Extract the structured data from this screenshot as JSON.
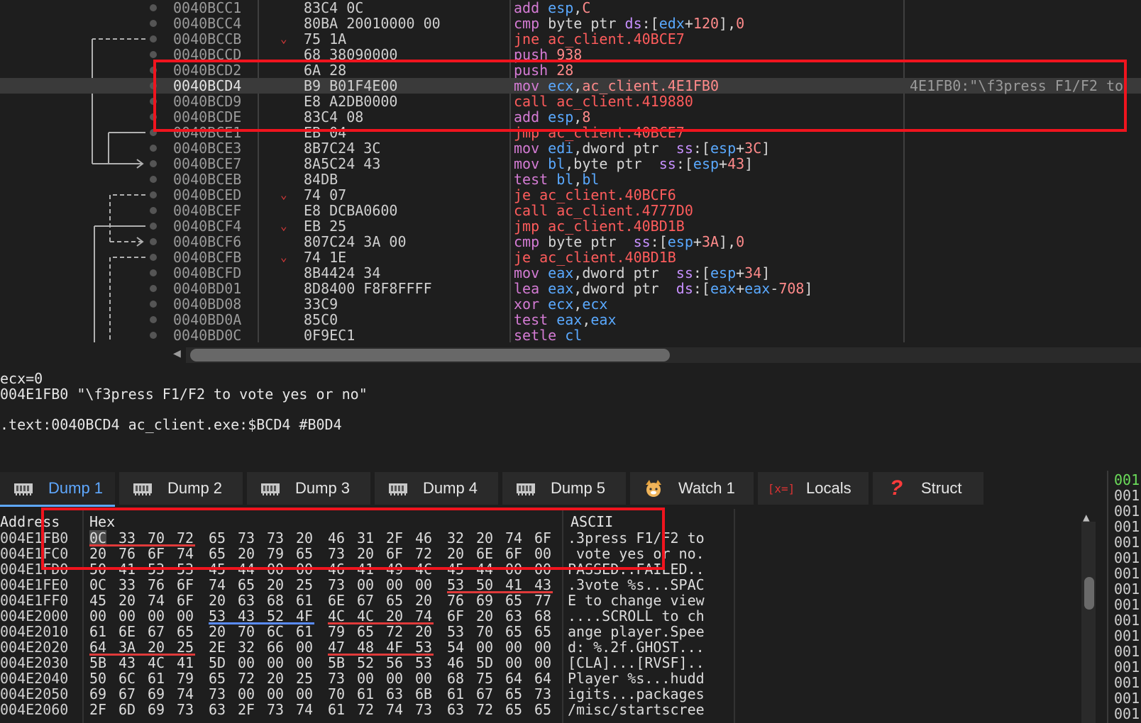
{
  "disasm": {
    "rows": [
      {
        "addr": "0040BCC1",
        "chev": "",
        "bytes": "83C4 0C",
        "parts": [
          [
            "add",
            "mn"
          ],
          [
            " ",
            "txt"
          ],
          [
            "esp",
            "reg"
          ],
          [
            ",",
            "txt"
          ],
          [
            "C",
            "imm"
          ]
        ]
      },
      {
        "addr": "0040BCC4",
        "chev": "",
        "bytes": "80BA 20010000 00",
        "parts": [
          [
            "cmp",
            "mn"
          ],
          [
            " byte ptr ",
            "txt"
          ],
          [
            "ds",
            "seg"
          ],
          [
            ":[",
            "txt"
          ],
          [
            "edx",
            "reg"
          ],
          [
            "+",
            "txt"
          ],
          [
            "120",
            "imm"
          ],
          [
            "],",
            "txt"
          ],
          [
            "0",
            "imm"
          ]
        ]
      },
      {
        "addr": "0040BCCB",
        "chev": "⌄",
        "bytes": "75 1A",
        "parts": [
          [
            "jne",
            "jmp"
          ],
          [
            " ",
            "txt"
          ],
          [
            "ac_client.40BCE7",
            "jmp"
          ]
        ]
      },
      {
        "addr": "0040BCCD",
        "chev": "",
        "bytes": "68 38090000",
        "parts": [
          [
            "push",
            "mn"
          ],
          [
            " ",
            "txt"
          ],
          [
            "938",
            "imm"
          ]
        ]
      },
      {
        "addr": "0040BCD2",
        "chev": "",
        "bytes": "6A 28",
        "parts": [
          [
            "push",
            "mn"
          ],
          [
            " ",
            "txt"
          ],
          [
            "28",
            "imm"
          ]
        ]
      },
      {
        "addr": "0040BCD4",
        "chev": "",
        "bytes": "B9 B01F4E00",
        "parts": [
          [
            "mov",
            "mn"
          ],
          [
            " ",
            "txt"
          ],
          [
            "ecx",
            "reg"
          ],
          [
            ",",
            "txt"
          ],
          [
            "ac_client.4E1FB0",
            "imm"
          ]
        ],
        "comment": "4E1FB0:\"\\f3press F1/F2 to",
        "selected": true
      },
      {
        "addr": "0040BCD9",
        "chev": "",
        "bytes": "E8 A2DB0000",
        "parts": [
          [
            "call",
            "jmp"
          ],
          [
            " ",
            "txt"
          ],
          [
            "ac_client.419880",
            "jmp"
          ]
        ]
      },
      {
        "addr": "0040BCDE",
        "chev": "",
        "bytes": "83C4 08",
        "parts": [
          [
            "add",
            "mn"
          ],
          [
            " ",
            "txt"
          ],
          [
            "esp",
            "reg"
          ],
          [
            ",",
            "txt"
          ],
          [
            "8",
            "imm"
          ]
        ]
      },
      {
        "addr": "0040BCE1",
        "chev": "",
        "bytes": "EB 04",
        "parts": [
          [
            "jmp",
            "jmp"
          ],
          [
            " ",
            "txt"
          ],
          [
            "ac_client.40BCE7",
            "jmp"
          ]
        ]
      },
      {
        "addr": "0040BCE3",
        "chev": "",
        "bytes": "8B7C24 3C",
        "parts": [
          [
            "mov",
            "mn"
          ],
          [
            " ",
            "txt"
          ],
          [
            "edi",
            "reg"
          ],
          [
            ",dword ptr  ",
            "txt"
          ],
          [
            "ss",
            "seg"
          ],
          [
            ":[",
            "txt"
          ],
          [
            "esp",
            "reg"
          ],
          [
            "+",
            "txt"
          ],
          [
            "3C",
            "imm"
          ],
          [
            "]",
            "txt"
          ]
        ]
      },
      {
        "addr": "0040BCE7",
        "chev": "",
        "bytes": "8A5C24 43",
        "parts": [
          [
            "mov",
            "mn"
          ],
          [
            " ",
            "txt"
          ],
          [
            "bl",
            "reg"
          ],
          [
            ",byte ptr  ",
            "txt"
          ],
          [
            "ss",
            "seg"
          ],
          [
            ":[",
            "txt"
          ],
          [
            "esp",
            "reg"
          ],
          [
            "+",
            "txt"
          ],
          [
            "43",
            "imm"
          ],
          [
            "]",
            "txt"
          ]
        ]
      },
      {
        "addr": "0040BCEB",
        "chev": "",
        "bytes": "84DB",
        "parts": [
          [
            "test",
            "mn"
          ],
          [
            " ",
            "txt"
          ],
          [
            "bl",
            "reg"
          ],
          [
            ",",
            "txt"
          ],
          [
            "bl",
            "reg"
          ]
        ]
      },
      {
        "addr": "0040BCED",
        "chev": "⌄",
        "bytes": "74 07",
        "parts": [
          [
            "je",
            "jmp"
          ],
          [
            " ",
            "txt"
          ],
          [
            "ac_client.40BCF6",
            "jmp"
          ]
        ]
      },
      {
        "addr": "0040BCEF",
        "chev": "",
        "bytes": "E8 DCBA0600",
        "parts": [
          [
            "call",
            "jmp"
          ],
          [
            " ",
            "txt"
          ],
          [
            "ac_client.4777D0",
            "jmp"
          ]
        ]
      },
      {
        "addr": "0040BCF4",
        "chev": "⌄",
        "bytes": "EB 25",
        "parts": [
          [
            "jmp",
            "jmp"
          ],
          [
            " ",
            "txt"
          ],
          [
            "ac_client.40BD1B",
            "jmp"
          ]
        ]
      },
      {
        "addr": "0040BCF6",
        "chev": "",
        "bytes": "807C24 3A 00",
        "parts": [
          [
            "cmp",
            "mn"
          ],
          [
            " byte ptr  ",
            "txt"
          ],
          [
            "ss",
            "seg"
          ],
          [
            ":[",
            "txt"
          ],
          [
            "esp",
            "reg"
          ],
          [
            "+",
            "txt"
          ],
          [
            "3A",
            "imm"
          ],
          [
            "],",
            "txt"
          ],
          [
            "0",
            "imm"
          ]
        ]
      },
      {
        "addr": "0040BCFB",
        "chev": "⌄",
        "bytes": "74 1E",
        "parts": [
          [
            "je",
            "jmp"
          ],
          [
            " ",
            "txt"
          ],
          [
            "ac_client.40BD1B",
            "jmp"
          ]
        ]
      },
      {
        "addr": "0040BCFD",
        "chev": "",
        "bytes": "8B4424 34",
        "parts": [
          [
            "mov",
            "mn"
          ],
          [
            " ",
            "txt"
          ],
          [
            "eax",
            "reg"
          ],
          [
            ",dword ptr  ",
            "txt"
          ],
          [
            "ss",
            "seg"
          ],
          [
            ":[",
            "txt"
          ],
          [
            "esp",
            "reg"
          ],
          [
            "+",
            "txt"
          ],
          [
            "34",
            "imm"
          ],
          [
            "]",
            "txt"
          ]
        ]
      },
      {
        "addr": "0040BD01",
        "chev": "",
        "bytes": "8D8400 F8F8FFFF",
        "parts": [
          [
            "lea",
            "mn"
          ],
          [
            " ",
            "txt"
          ],
          [
            "eax",
            "reg"
          ],
          [
            ",dword ptr  ",
            "txt"
          ],
          [
            "ds",
            "seg"
          ],
          [
            ":[",
            "txt"
          ],
          [
            "eax",
            "reg"
          ],
          [
            "+",
            "txt"
          ],
          [
            "eax",
            "reg"
          ],
          [
            "-",
            "txt"
          ],
          [
            "708",
            "imm"
          ],
          [
            "]",
            "txt"
          ]
        ]
      },
      {
        "addr": "0040BD08",
        "chev": "",
        "bytes": "33C9",
        "parts": [
          [
            "xor",
            "mn"
          ],
          [
            " ",
            "txt"
          ],
          [
            "ecx",
            "reg"
          ],
          [
            ",",
            "txt"
          ],
          [
            "ecx",
            "reg"
          ]
        ]
      },
      {
        "addr": "0040BD0A",
        "chev": "",
        "bytes": "85C0",
        "parts": [
          [
            "test",
            "mn"
          ],
          [
            " ",
            "txt"
          ],
          [
            "eax",
            "reg"
          ],
          [
            ",",
            "txt"
          ],
          [
            "eax",
            "reg"
          ]
        ]
      },
      {
        "addr": "0040BD0C",
        "chev": "",
        "bytes": "0F9EC1",
        "parts": [
          [
            "setle",
            "mn"
          ],
          [
            " ",
            "txt"
          ],
          [
            "cl",
            "reg"
          ]
        ]
      }
    ]
  },
  "info": {
    "line1": "ecx=0",
    "line2": "004E1FB0 \"\\f3press F1/F2 to vote yes or no\"",
    "line3": ".text:0040BCD4 ac_client.exe:$BCD4 #B0D4"
  },
  "tabs": [
    {
      "label": "Dump 1",
      "icon": "memory-icon",
      "active": true
    },
    {
      "label": "Dump 2",
      "icon": "memory-icon"
    },
    {
      "label": "Dump 3",
      "icon": "memory-icon"
    },
    {
      "label": "Dump 4",
      "icon": "memory-icon"
    },
    {
      "label": "Dump 5",
      "icon": "memory-icon"
    },
    {
      "label": "Watch 1",
      "icon": "watch-icon"
    },
    {
      "label": "Locals",
      "icon": "locals-icon",
      "iconText": "[x=]"
    },
    {
      "label": "Struct",
      "icon": "struct-icon",
      "iconText": "?"
    }
  ],
  "dump": {
    "headers": {
      "address": "Address",
      "hex": "Hex",
      "ascii": "ASCII"
    },
    "rows": [
      {
        "addr": "004E1FB0",
        "hex": [
          "0C",
          "33",
          "70",
          "72",
          "65",
          "73",
          "73",
          "20",
          "46",
          "31",
          "2F",
          "46",
          "32",
          "20",
          "74",
          "6F"
        ],
        "ascii": ".3press F1/F2 to"
      },
      {
        "addr": "004E1FC0",
        "hex": [
          "20",
          "76",
          "6F",
          "74",
          "65",
          "20",
          "79",
          "65",
          "73",
          "20",
          "6F",
          "72",
          "20",
          "6E",
          "6F",
          "00"
        ],
        "ascii": " vote yes or no."
      },
      {
        "addr": "004E1FD0",
        "hex": [
          "50",
          "41",
          "53",
          "53",
          "45",
          "44",
          "00",
          "00",
          "46",
          "41",
          "49",
          "4C",
          "45",
          "44",
          "00",
          "00"
        ],
        "ascii": "PASSED..FAILED.."
      },
      {
        "addr": "004E1FE0",
        "hex": [
          "0C",
          "33",
          "76",
          "6F",
          "74",
          "65",
          "20",
          "25",
          "73",
          "00",
          "00",
          "00",
          "53",
          "50",
          "41",
          "43"
        ],
        "ascii": ".3vote %s...SPAC"
      },
      {
        "addr": "004E1FF0",
        "hex": [
          "45",
          "20",
          "74",
          "6F",
          "20",
          "63",
          "68",
          "61",
          "6E",
          "67",
          "65",
          "20",
          "76",
          "69",
          "65",
          "77"
        ],
        "ascii": "E to change view"
      },
      {
        "addr": "004E2000",
        "hex": [
          "00",
          "00",
          "00",
          "00",
          "53",
          "43",
          "52",
          "4F",
          "4C",
          "4C",
          "20",
          "74",
          "6F",
          "20",
          "63",
          "68"
        ],
        "ascii": "....SCROLL to ch"
      },
      {
        "addr": "004E2010",
        "hex": [
          "61",
          "6E",
          "67",
          "65",
          "20",
          "70",
          "6C",
          "61",
          "79",
          "65",
          "72",
          "20",
          "53",
          "70",
          "65",
          "65"
        ],
        "ascii": "ange player.Spee"
      },
      {
        "addr": "004E2020",
        "hex": [
          "64",
          "3A",
          "20",
          "25",
          "2E",
          "32",
          "66",
          "00",
          "47",
          "48",
          "4F",
          "53",
          "54",
          "00",
          "00",
          "00"
        ],
        "ascii": "d: %.2f.GHOST..."
      },
      {
        "addr": "004E2030",
        "hex": [
          "5B",
          "43",
          "4C",
          "41",
          "5D",
          "00",
          "00",
          "00",
          "5B",
          "52",
          "56",
          "53",
          "46",
          "5D",
          "00",
          "00"
        ],
        "ascii": "[CLA]...[RVSF].."
      },
      {
        "addr": "004E2040",
        "hex": [
          "50",
          "6C",
          "61",
          "79",
          "65",
          "72",
          "20",
          "25",
          "73",
          "00",
          "00",
          "00",
          "68",
          "75",
          "64",
          "64"
        ],
        "ascii": "Player %s...hudd"
      },
      {
        "addr": "004E2050",
        "hex": [
          "69",
          "67",
          "69",
          "74",
          "73",
          "00",
          "00",
          "00",
          "70",
          "61",
          "63",
          "6B",
          "61",
          "67",
          "65",
          "73"
        ],
        "ascii": "igits...packages"
      },
      {
        "addr": "004E2060",
        "hex": [
          "2F",
          "6D",
          "69",
          "73",
          "63",
          "2F",
          "73",
          "74",
          "61",
          "72",
          "74",
          "73",
          "63",
          "72",
          "65",
          "65"
        ],
        "ascii": "/misc/startscree"
      }
    ]
  },
  "stack": {
    "items": [
      "001",
      "001",
      "001",
      "001",
      "001",
      "001",
      "001",
      "001",
      "001",
      "001",
      "001",
      "001",
      "001",
      "001",
      "001",
      "001"
    ]
  },
  "colors": {
    "redbox": "#f0141e",
    "accent": "#5fa8ff",
    "underline_red": "#e03a3a",
    "underline_blue": "#5a8cff"
  }
}
